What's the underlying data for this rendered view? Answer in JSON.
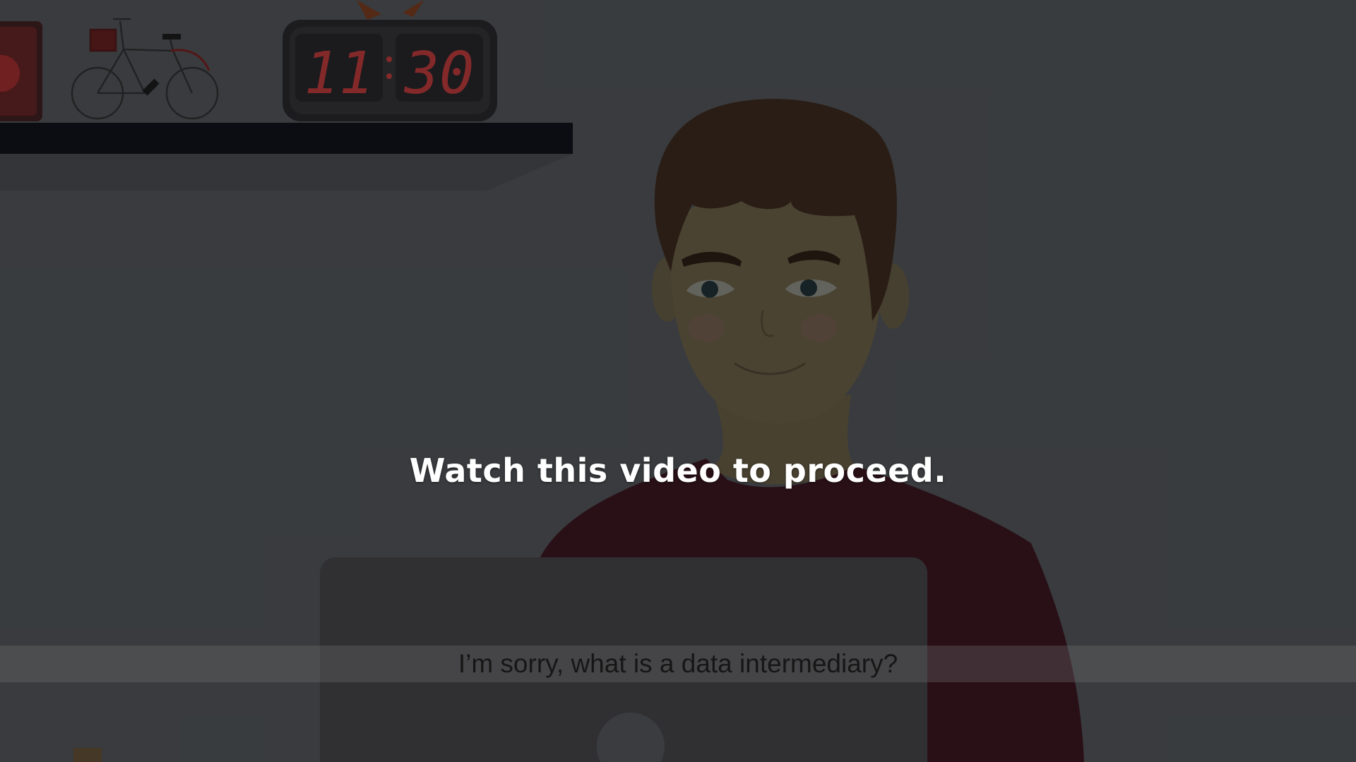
{
  "overlay": {
    "prompt": "Watch this video to proceed."
  },
  "video": {
    "subtitle": "I’m sorry, what is a data intermediary?",
    "clock": {
      "hours": "11",
      "minutes": "30"
    }
  },
  "colors": {
    "background": "#3b3e40",
    "shelf": "#090a10",
    "clock_digits": "#8f2a2a",
    "hair": "#2b1c12",
    "shirt": "#2a0e15",
    "prompt_text": "#ffffff",
    "subtitle_text": "#161616"
  },
  "icons": [
    "bicycle-icon",
    "digital-clock-icon",
    "speaker-icon",
    "laptop-icon"
  ]
}
